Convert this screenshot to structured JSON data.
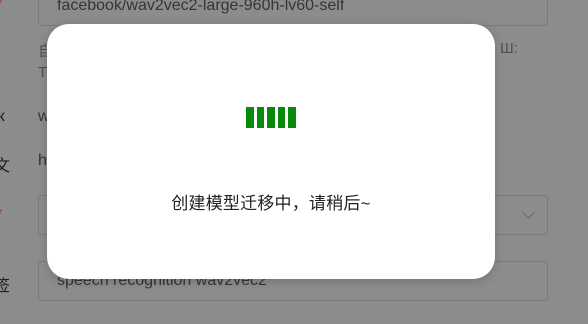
{
  "form": {
    "model_path_value": "facebook/wav2vec2-large-960h-lv60-self",
    "hint_line1_left": "自",
    "hint_line1_right": "Ш:",
    "hint_line2_left": "T",
    "row_w_text": "w",
    "row_h_text": "h",
    "select_placeholder": "",
    "tags_value": "speech recognition wav2vec2",
    "required_mark": "*"
  },
  "dialog": {
    "message": "创建模型迁移中，请稍后~",
    "spinner_color": "#0a8a0a"
  },
  "colors": {
    "mask": "rgba(0,0,0,0.45)",
    "required": "#f56c6c"
  }
}
